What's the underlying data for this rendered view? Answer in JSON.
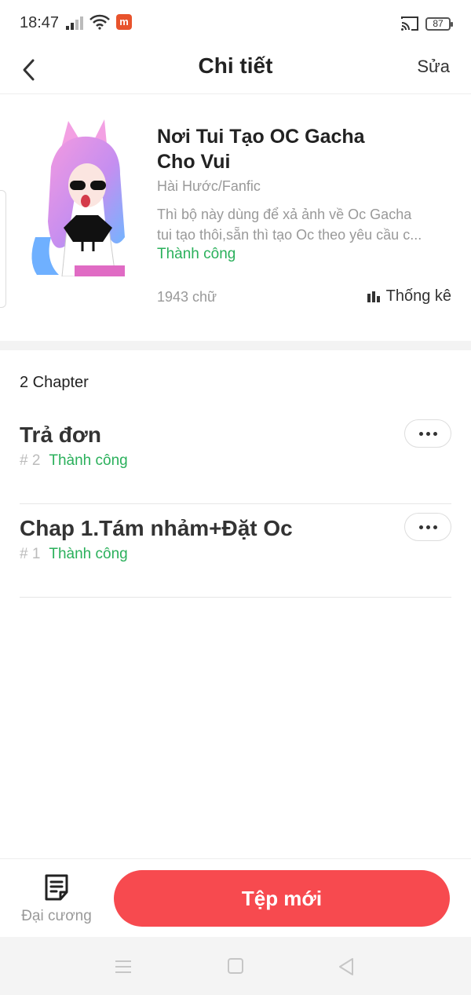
{
  "status_bar": {
    "time": "18:47",
    "battery": "87",
    "app_badge": "m"
  },
  "header": {
    "title": "Chi tiết",
    "edit_label": "Sửa"
  },
  "story": {
    "title": "Nơi Tui Tạo OC Gacha Cho Vui",
    "genre": "Hài Hước/Fanfic",
    "description_line1": "Thì bộ này dùng để xả ảnh về Oc Gacha",
    "description_line2": "tui tạo thôi,sẵn thì tạo Oc theo yêu cầu c...",
    "status": "Thành công",
    "word_count": "1943 chữ",
    "stats_label": "Thống kê"
  },
  "chapters": {
    "count_label": "2 Chapter",
    "items": [
      {
        "title": "Trả đơn",
        "number": "# 2",
        "status": "Thành công"
      },
      {
        "title": "Chap 1.Tám nhảm+Đặt Oc",
        "number": "# 1",
        "status": "Thành công"
      }
    ]
  },
  "bottom_bar": {
    "outline_label": "Đại cương",
    "new_file_label": "Tệp mới"
  },
  "colors": {
    "accent": "#f74a4f",
    "success": "#2ab05b"
  },
  "icons": [
    "back-arrow-icon",
    "wifi-icon",
    "signal-icon",
    "cast-icon",
    "battery-icon",
    "bar-chart-icon",
    "more-dots-icon",
    "document-icon",
    "menu-icon",
    "home-square-icon",
    "back-triangle-icon"
  ]
}
